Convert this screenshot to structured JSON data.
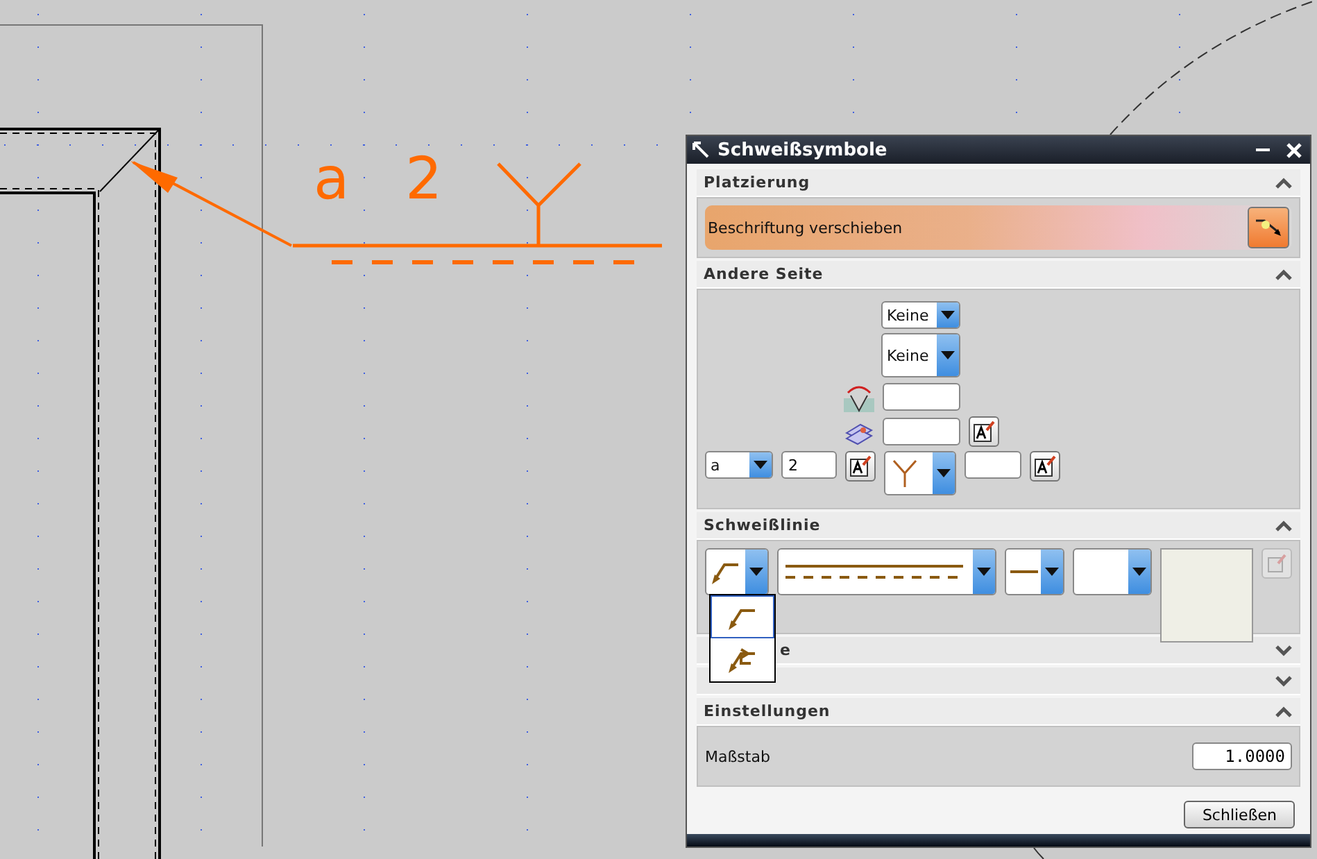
{
  "drawing": {
    "annotation_texts": [
      "a",
      "2"
    ]
  },
  "dialog": {
    "title": "Schweißsymbole",
    "sections": [
      {
        "kind": "placement",
        "title": "Platzierung",
        "expanded": true,
        "action": "Beschriftung verschieben"
      },
      {
        "kind": "other-side",
        "title": "Andere Seite",
        "expanded": true,
        "dropdown_1": "Keine",
        "dropdown_2": "Keine",
        "size_select": "a",
        "size_value": "2"
      },
      {
        "kind": "weld-line",
        "title": "Schweißlinie",
        "expanded": true,
        "popup": [
          {
            "selected": true
          },
          {
            "selected": false
          }
        ]
      },
      {
        "kind": "collapsed",
        "title": "e",
        "expanded": false
      },
      {
        "kind": "collapsed",
        "expanded": false
      },
      {
        "kind": "settings",
        "title": "Einstellungen",
        "expanded": true,
        "scale_label": "Maßstab",
        "scale_value": "1.0000"
      }
    ],
    "close_button": "Schließen"
  }
}
